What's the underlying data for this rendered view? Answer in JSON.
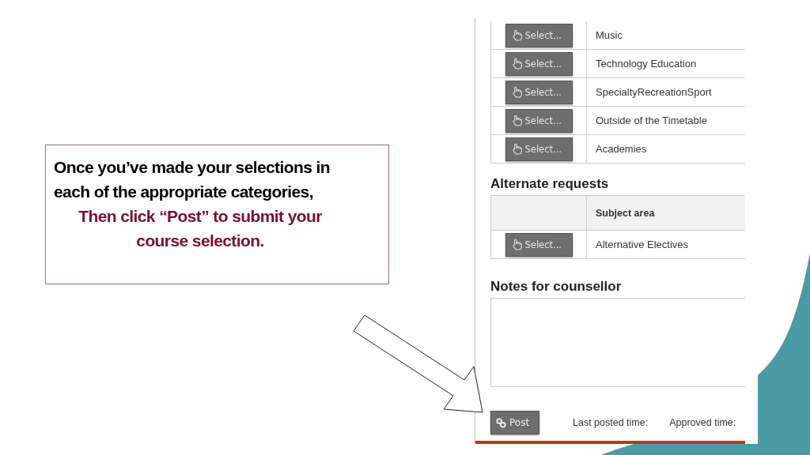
{
  "callout": {
    "intro": "Once you’ve made your selections in each of the appropriate categories,",
    "instruction": "Then click “Post” to submit your course selection."
  },
  "requests": {
    "rows": [
      {
        "button": "Select...",
        "subject": "Music"
      },
      {
        "button": "Select...",
        "subject": "Technology Education"
      },
      {
        "button": "Select...",
        "subject": "SpecialtyRecreationSport"
      },
      {
        "button": "Select...",
        "subject": "Outside of the Timetable"
      },
      {
        "button": "Select...",
        "subject": "Academies"
      }
    ]
  },
  "alternate": {
    "title": "Alternate requests",
    "header": "Subject area",
    "rows": [
      {
        "button": "Select...",
        "subject": "Alternative Electives"
      }
    ]
  },
  "notes": {
    "title": "Notes for counsellor"
  },
  "footer": {
    "post_button": "Post",
    "last_posted": "Last posted time:",
    "approved": "Approved time:"
  }
}
